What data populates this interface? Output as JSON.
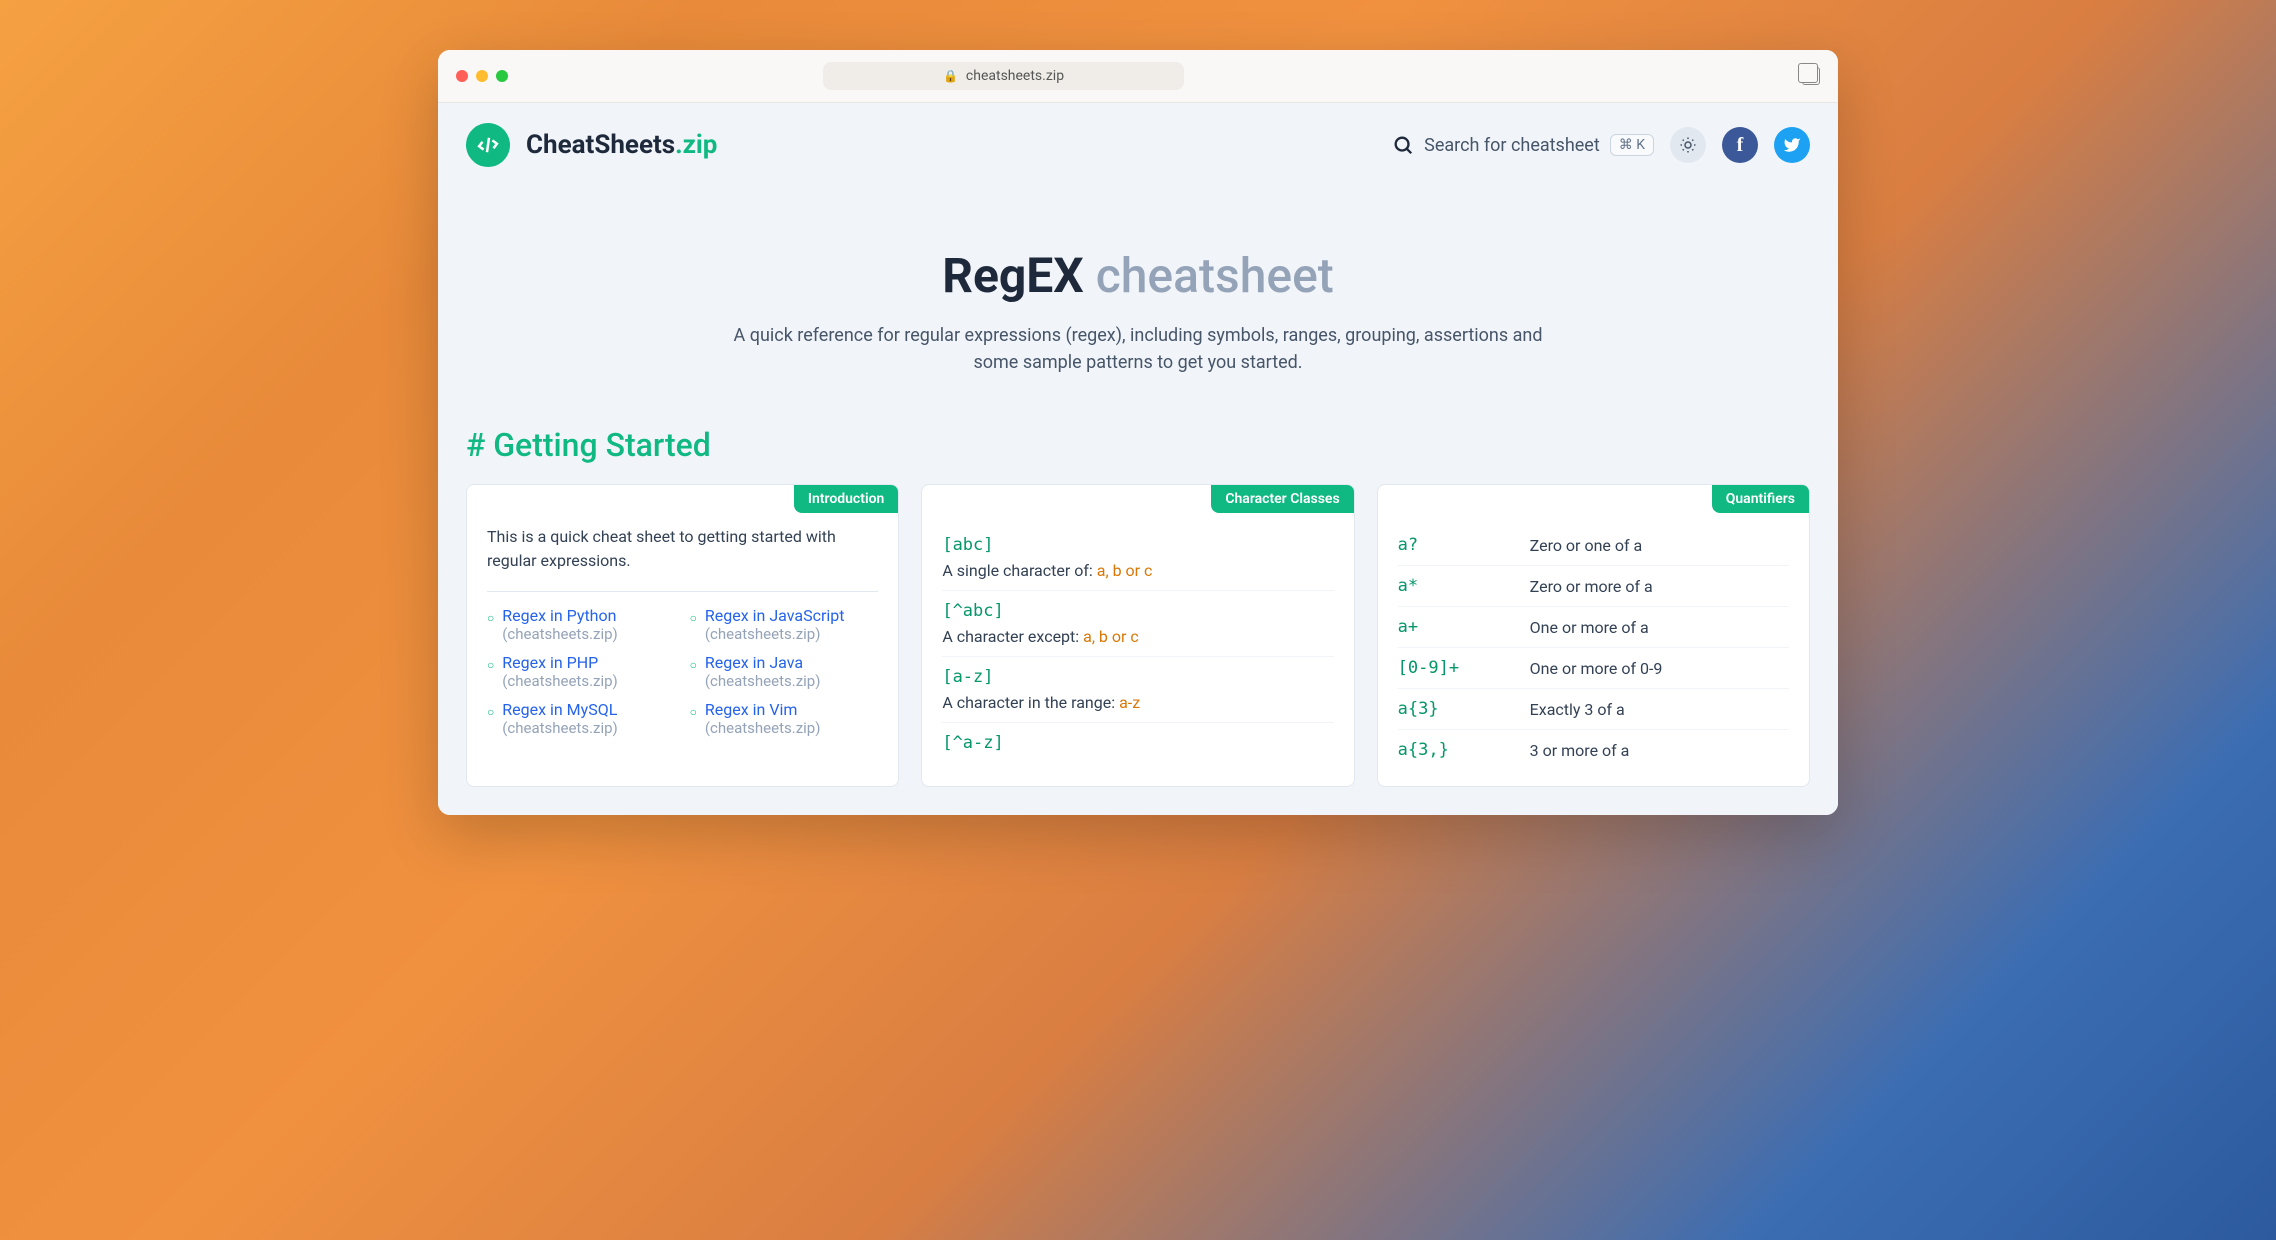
{
  "browser": {
    "url": "cheatsheets.zip"
  },
  "header": {
    "brand_main": "CheatSheets",
    "brand_ext": ".zip",
    "search_placeholder": "Search for cheatsheet",
    "search_kbd": "⌘ K"
  },
  "hero": {
    "title_strong": "RegEX",
    "title_muted": "cheatsheet",
    "description": "A quick reference for regular expressions (regex), including symbols, ranges, grouping, assertions and some sample patterns to get you started."
  },
  "section": {
    "title": "# Getting Started"
  },
  "intro_card": {
    "badge": "Introduction",
    "text": "This is a quick cheat sheet to getting started with regular expressions.",
    "links": [
      {
        "label": "Regex in Python",
        "sub": "(cheatsheets.zip)"
      },
      {
        "label": "Regex in JavaScript",
        "sub": "(cheatsheets.zip)"
      },
      {
        "label": "Regex in PHP",
        "sub": "(cheatsheets.zip)"
      },
      {
        "label": "Regex in Java",
        "sub": "(cheatsheets.zip)"
      },
      {
        "label": "Regex in MySQL",
        "sub": "(cheatsheets.zip)"
      },
      {
        "label": "Regex in Vim",
        "sub": "(cheatsheets.zip)"
      }
    ]
  },
  "char_card": {
    "badge": "Character Classes",
    "rows": [
      {
        "code": "[abc]",
        "desc_pre": "A single character of: ",
        "desc_hl": "a, b or c"
      },
      {
        "code": "[^abc]",
        "desc_pre": "A character except: ",
        "desc_hl": "a, b or c"
      },
      {
        "code": "[a-z]",
        "desc_pre": "A character in the range: ",
        "desc_hl": "a-z"
      },
      {
        "code": "[^a-z]",
        "desc_pre": "",
        "desc_hl": ""
      }
    ]
  },
  "quant_card": {
    "badge": "Quantifiers",
    "rows": [
      {
        "code": "a?",
        "desc": "Zero or one of a"
      },
      {
        "code": "a*",
        "desc": "Zero or more of a"
      },
      {
        "code": "a+",
        "desc": "One or more of a"
      },
      {
        "code": "[0-9]+",
        "desc": "One or more of 0-9"
      },
      {
        "code": "a{3}",
        "desc": "Exactly 3 of a"
      },
      {
        "code": "a{3,}",
        "desc": "3 or more of a"
      }
    ]
  }
}
